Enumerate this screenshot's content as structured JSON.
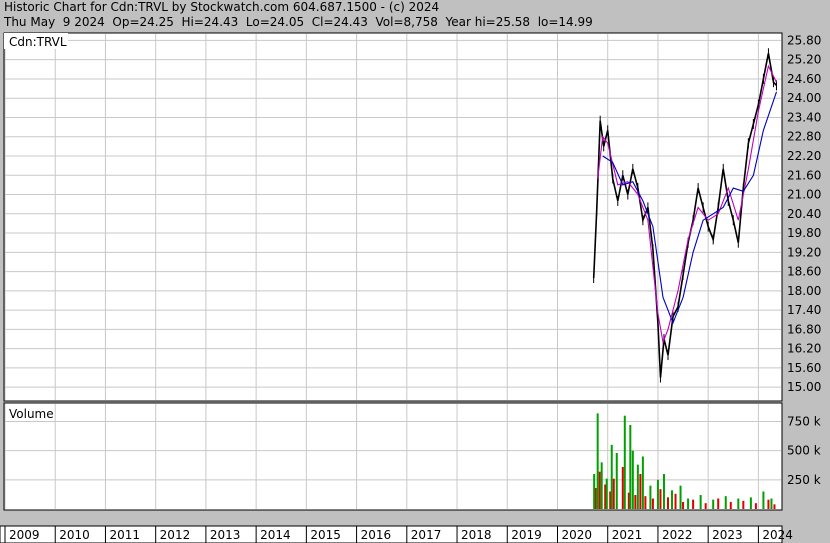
{
  "header": {
    "line1": "Historic Chart for Cdn:TRVL by Stockwatch.com 604.687.1500 - (c) 2024",
    "line2": "Thu May  9 2024  Op=24.25  Hi=24.43  Lo=24.05  Cl=24.43  Vol=8,758  Year hi=25.58  lo=14.99"
  },
  "chart_data": [
    {
      "type": "line",
      "label": "Cdn:TRVL",
      "y_ticks": [
        "25.80",
        "25.20",
        "24.60",
        "24.00",
        "23.40",
        "22.80",
        "22.20",
        "21.60",
        "21.00",
        "20.40",
        "19.80",
        "19.20",
        "18.60",
        "18.00",
        "17.40",
        "16.80",
        "16.20",
        "15.60",
        "15.00"
      ],
      "ylim": [
        14.6,
        26.0
      ],
      "x_tick_labels": [
        "2009",
        "2010",
        "2011",
        "2012",
        "2013",
        "2014",
        "2015",
        "2016",
        "2017",
        "2018",
        "2019",
        "2020",
        "2021",
        "2022",
        "2023",
        "2024"
      ],
      "xlim": [
        2009.0,
        2024.45
      ],
      "grid": true,
      "series": [
        {
          "color": "#000000",
          "x": [
            2020.72,
            2020.78,
            2020.85,
            2020.92,
            2021.0,
            2021.1,
            2021.2,
            2021.3,
            2021.4,
            2021.5,
            2021.6,
            2021.7,
            2021.8,
            2021.9,
            2022.0,
            2022.05,
            2022.12,
            2022.2,
            2022.3,
            2022.4,
            2022.5,
            2022.6,
            2022.7,
            2022.8,
            2022.9,
            2023.0,
            2023.1,
            2023.2,
            2023.3,
            2023.4,
            2023.5,
            2023.6,
            2023.7,
            2023.8,
            2023.9,
            2024.0,
            2024.1,
            2024.2,
            2024.3,
            2024.36
          ],
          "y": [
            18.4,
            20.5,
            23.3,
            22.5,
            23.0,
            21.5,
            20.8,
            21.6,
            21.0,
            21.8,
            21.2,
            20.2,
            20.6,
            19.3,
            17.0,
            15.3,
            16.5,
            16.0,
            17.2,
            17.5,
            18.5,
            19.5,
            20.2,
            21.2,
            20.6,
            20.0,
            19.6,
            20.6,
            21.8,
            20.8,
            20.2,
            19.5,
            21.2,
            22.6,
            23.2,
            23.8,
            24.6,
            25.4,
            24.5,
            24.4
          ]
        },
        {
          "color": "#c000c0",
          "x": [
            2020.8,
            2020.9,
            2021.0,
            2021.2,
            2021.4,
            2021.6,
            2021.8,
            2022.0,
            2022.1,
            2022.2,
            2022.4,
            2022.6,
            2022.8,
            2023.0,
            2023.2,
            2023.4,
            2023.6,
            2023.8,
            2024.0,
            2024.2,
            2024.36
          ],
          "y": [
            21.5,
            22.8,
            22.6,
            21.3,
            21.4,
            21.0,
            20.2,
            17.3,
            16.4,
            16.8,
            18.0,
            19.6,
            20.6,
            20.2,
            20.4,
            21.2,
            20.2,
            21.8,
            23.6,
            25.0,
            24.5
          ]
        },
        {
          "color": "#0000c0",
          "x": [
            2020.9,
            2021.1,
            2021.3,
            2021.5,
            2021.7,
            2021.9,
            2022.1,
            2022.3,
            2022.5,
            2022.7,
            2022.9,
            2023.1,
            2023.3,
            2023.5,
            2023.7,
            2023.9,
            2024.1,
            2024.36
          ],
          "y": [
            22.2,
            22.0,
            21.3,
            21.4,
            20.8,
            20.0,
            17.8,
            17.0,
            17.8,
            19.2,
            20.2,
            20.4,
            20.6,
            21.2,
            21.1,
            21.6,
            23.0,
            24.2
          ]
        }
      ]
    },
    {
      "type": "bar",
      "label": "Volume",
      "y_ticks": [
        "750 k",
        "500 k",
        "250 k"
      ],
      "ylim": [
        0,
        900000
      ],
      "series": [
        {
          "name": "",
          "color": "#e00000",
          "x": [
            2020.76,
            2020.84,
            2020.95,
            2021.05,
            2021.12,
            2021.3,
            2021.42,
            2021.55,
            2021.65,
            2021.75,
            2021.9,
            2022.05,
            2022.2,
            2022.35,
            2022.5,
            2022.7,
            2022.95,
            2023.2,
            2023.45,
            2023.7,
            2023.95,
            2024.2,
            2024.32
          ],
          "y": [
            180000,
            320000,
            210000,
            150000,
            260000,
            360000,
            140000,
            120000,
            300000,
            110000,
            90000,
            170000,
            100000,
            130000,
            60000,
            80000,
            50000,
            90000,
            60000,
            70000,
            50000,
            80000,
            40000
          ]
        },
        {
          "name": "",
          "color": "#00a000",
          "x": [
            2020.73,
            2020.8,
            2020.88,
            2020.98,
            2021.08,
            2021.18,
            2021.34,
            2021.45,
            2021.5,
            2021.6,
            2021.7,
            2021.85,
            2022.0,
            2022.12,
            2022.28,
            2022.45,
            2022.6,
            2022.85,
            2023.1,
            2023.35,
            2023.6,
            2023.85,
            2024.1,
            2024.26
          ],
          "y": [
            300000,
            820000,
            400000,
            260000,
            550000,
            480000,
            800000,
            720000,
            500000,
            380000,
            450000,
            200000,
            250000,
            300000,
            160000,
            200000,
            90000,
            120000,
            80000,
            110000,
            90000,
            100000,
            150000,
            90000
          ]
        }
      ]
    }
  ]
}
